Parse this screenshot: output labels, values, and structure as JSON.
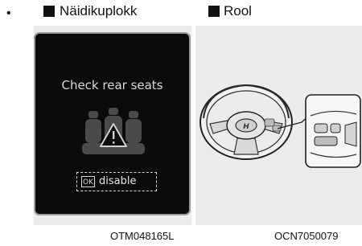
{
  "bullet": "•",
  "left_panel": {
    "title": "Näidikuplokk",
    "message": "Check rear seats",
    "ok_key": "OK",
    "ok_action": "disable",
    "caption": "OTM048165L"
  },
  "right_panel": {
    "title": "Rool",
    "caption": "OCN7050079"
  },
  "icons": [
    "rear-seat-warning-icon",
    "steering-wheel-illustration"
  ]
}
